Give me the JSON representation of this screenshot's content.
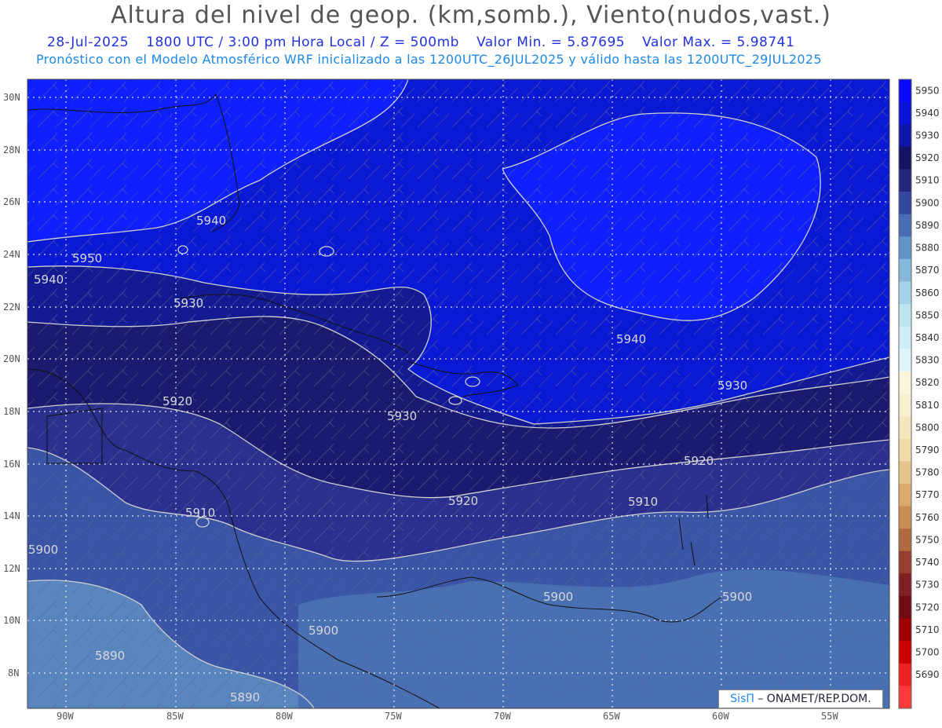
{
  "header": {
    "title": "Altura del nivel de geop. (km,somb.), Viento(nudos,vast.)",
    "date": "28-Jul-2025",
    "time": "1800 UTC / 3:00 pm Hora Local / Z = 500mb",
    "min_label": "Valor Min. = 5.87695",
    "max_label": "Valor Max. = 5.98741",
    "model_line": "Pronóstico con el Modelo Atmosférico WRF inicializado a las 1200UTC_26JUL2025 y válido hasta las  1200UTC_29JUL2025"
  },
  "map": {
    "lat_labels": [
      "30N",
      "28N",
      "26N",
      "24N",
      "22N",
      "20N",
      "18N",
      "16N",
      "14N",
      "12N",
      "10N",
      "8N"
    ],
    "lon_labels": [
      "90W",
      "85W",
      "80W",
      "75W",
      "70W",
      "65W",
      "60W",
      "55W"
    ],
    "contour_labels": [
      {
        "text": "5950",
        "key": "c5950a"
      },
      {
        "text": "5940",
        "key": "c5940a"
      },
      {
        "text": "5940",
        "key": "c5940b"
      },
      {
        "text": "5930",
        "key": "c5930a"
      },
      {
        "text": "5940",
        "key": "c5940c"
      },
      {
        "text": "5930",
        "key": "c5930b"
      },
      {
        "text": "5920",
        "key": "c5920a"
      },
      {
        "text": "5930",
        "key": "c5930c"
      },
      {
        "text": "5920",
        "key": "c5920b"
      },
      {
        "text": "5920",
        "key": "c5920c"
      },
      {
        "text": "5910",
        "key": "c5910a"
      },
      {
        "text": "5910",
        "key": "c5910b"
      },
      {
        "text": "5900",
        "key": "c5900a"
      },
      {
        "text": "5900",
        "key": "c5900b"
      },
      {
        "text": "5900",
        "key": "c5900c"
      },
      {
        "text": "5900",
        "key": "c5900d"
      },
      {
        "text": "5890",
        "key": "c5890a"
      },
      {
        "text": "5890",
        "key": "c5890b"
      }
    ],
    "colors": {
      "c5950": "#0f1ffe",
      "c5940": "#0a1ad4",
      "c5930": "#141a92",
      "c5920": "#1b1a6e",
      "c5910": "#2b2f8e",
      "c5900": "#3a55a6",
      "c5890": "#5a86bf"
    }
  },
  "colorbar": {
    "levels": [
      "5950",
      "5940",
      "5930",
      "5920",
      "5910",
      "5900",
      "5890",
      "5880",
      "5870",
      "5860",
      "5850",
      "5840",
      "5830",
      "5820",
      "5810",
      "5800",
      "5790",
      "5780",
      "5770",
      "5760",
      "5750",
      "5740",
      "5730",
      "5720",
      "5710",
      "5700",
      "5690"
    ],
    "colors": [
      "#0808ff",
      "#0a14d8",
      "#0d16a6",
      "#141466",
      "#23287d",
      "#3346a0",
      "#4a6cb4",
      "#6495c8",
      "#86b8dc",
      "#a6d3ea",
      "#bde5f1",
      "#cfeef6",
      "#e0f5fa",
      "#fbf5dc",
      "#f8efd0",
      "#f4e7bf",
      "#efdcaa",
      "#e6c58c",
      "#d9aa6c",
      "#c88e55",
      "#b06a40",
      "#963f30",
      "#7e1f22",
      "#6e0c12",
      "#a00000",
      "#cc0000",
      "#ee2222",
      "#ff3a3a"
    ]
  },
  "credit": {
    "brand": "SisΠ",
    "rest": "– ONAMET/REP.DOM."
  }
}
